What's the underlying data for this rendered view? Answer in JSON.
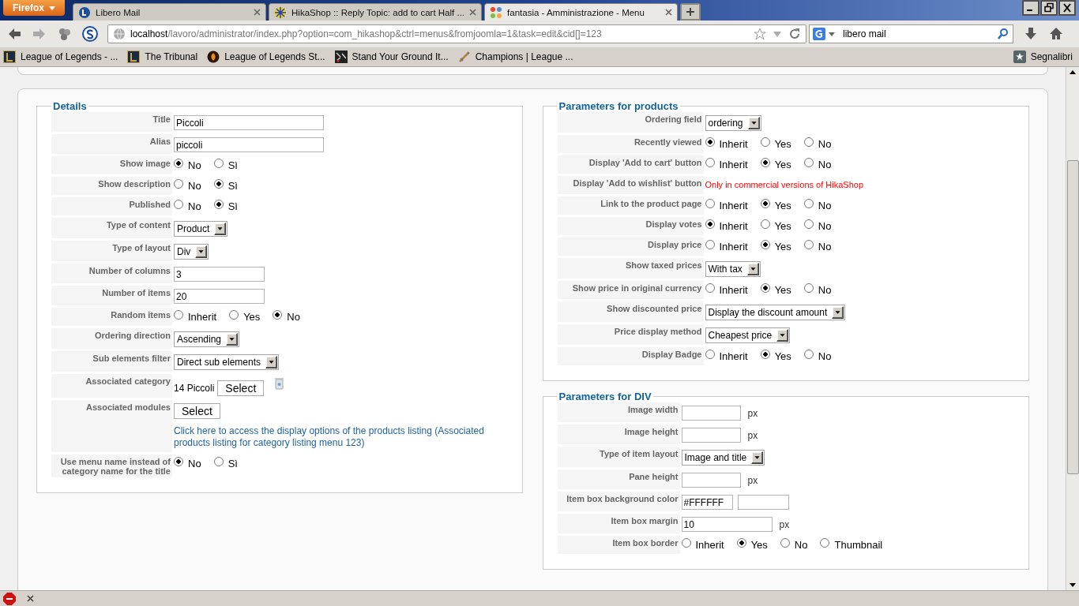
{
  "browser": {
    "menu_button": "Firefox",
    "tabs": [
      {
        "title": "Libero Mail",
        "selected": false
      },
      {
        "title": "HikaShop :: Reply Topic: add to cart Half ...",
        "selected": false
      },
      {
        "title": "fantasia - Amministrazione - Menu",
        "selected": true
      }
    ],
    "url": {
      "host": "localhost",
      "path": "/lavoro/administrator/index.php?option=com_hikashop&ctrl=menus&fromjoomla=1&task=edit&cid[]=123"
    },
    "search": "libero mail",
    "bookmarks": [
      "League of Legends - ...",
      "The Tribunal",
      "League of Legends St...",
      "Stand Your Ground It...",
      "Champions | League ..."
    ],
    "bookmarks_menu": "Segnalibri"
  },
  "details": {
    "legend": "Details",
    "rows": [
      {
        "kind": "text",
        "label": "Title",
        "value": "Piccoli"
      },
      {
        "kind": "text",
        "label": "Alias",
        "value": "piccoli"
      },
      {
        "kind": "radio",
        "label": "Show image",
        "options": [
          {
            "label": "No",
            "selected": true
          },
          {
            "label": "Sì",
            "selected": false
          }
        ]
      },
      {
        "kind": "radio",
        "label": "Show description",
        "options": [
          {
            "label": "No",
            "selected": false
          },
          {
            "label": "Sì",
            "selected": true
          }
        ]
      },
      {
        "kind": "radio",
        "label": "Published",
        "options": [
          {
            "label": "No",
            "selected": false
          },
          {
            "label": "Sì",
            "selected": true
          }
        ]
      },
      {
        "kind": "select",
        "label": "Type of content",
        "value": "Product"
      },
      {
        "kind": "select",
        "label": "Type of layout",
        "value": "Div"
      },
      {
        "kind": "number",
        "label": "Number of columns",
        "value": "3"
      },
      {
        "kind": "number",
        "label": "Number of items",
        "value": "20"
      },
      {
        "kind": "radio",
        "label": "Random items",
        "options": [
          {
            "label": "Inherit",
            "selected": false
          },
          {
            "label": "Yes",
            "selected": false
          },
          {
            "label": "No",
            "selected": true
          }
        ]
      },
      {
        "kind": "select",
        "label": "Ordering direction",
        "value": "Ascending"
      },
      {
        "kind": "select",
        "label": "Sub elements filter",
        "value": "Direct sub elements"
      },
      {
        "kind": "category",
        "label": "Associated category",
        "value": "14 Piccoli",
        "button": "Select"
      },
      {
        "kind": "modules",
        "label": "Associated modules",
        "button": "Select",
        "link": "Click here to access the display options of the products listing (Associated products listing for category listing menu 123)"
      },
      {
        "kind": "radio",
        "label": "Use menu name instead of category name for the title",
        "options": [
          {
            "label": "No",
            "selected": true
          },
          {
            "label": "Sì",
            "selected": false
          }
        ]
      }
    ]
  },
  "products": {
    "legend": "Parameters for products",
    "rows": [
      {
        "kind": "select",
        "label": "Ordering field",
        "value": "ordering"
      },
      {
        "kind": "radio",
        "label": "Recently viewed",
        "options": [
          {
            "label": "Inherit",
            "selected": true
          },
          {
            "label": "Yes",
            "selected": false
          },
          {
            "label": "No",
            "selected": false
          }
        ]
      },
      {
        "kind": "radio",
        "label": "Display 'Add to cart' button",
        "options": [
          {
            "label": "Inherit",
            "selected": false
          },
          {
            "label": "Yes",
            "selected": true
          },
          {
            "label": "No",
            "selected": false
          }
        ]
      },
      {
        "kind": "note",
        "label": "Display 'Add to wishlist' button",
        "text": "Only in commercial versions of HikaShop"
      },
      {
        "kind": "radio",
        "label": "Link to the product page",
        "options": [
          {
            "label": "Inherit",
            "selected": false
          },
          {
            "label": "Yes",
            "selected": true
          },
          {
            "label": "No",
            "selected": false
          }
        ]
      },
      {
        "kind": "radio",
        "label": "Display votes",
        "options": [
          {
            "label": "Inherit",
            "selected": true
          },
          {
            "label": "Yes",
            "selected": false
          },
          {
            "label": "No",
            "selected": false
          }
        ]
      },
      {
        "kind": "radio",
        "label": "Display price",
        "options": [
          {
            "label": "Inherit",
            "selected": false
          },
          {
            "label": "Yes",
            "selected": true
          },
          {
            "label": "No",
            "selected": false
          }
        ]
      },
      {
        "kind": "select",
        "label": "Show taxed prices",
        "value": "With tax"
      },
      {
        "kind": "radio",
        "label": "Show price in original currency",
        "options": [
          {
            "label": "Inherit",
            "selected": false
          },
          {
            "label": "Yes",
            "selected": true
          },
          {
            "label": "No",
            "selected": false
          }
        ]
      },
      {
        "kind": "select",
        "label": "Show discounted price",
        "value": "Display the discount amount"
      },
      {
        "kind": "select",
        "label": "Price display method",
        "value": "Cheapest price"
      },
      {
        "kind": "radio",
        "label": "Display Badge",
        "options": [
          {
            "label": "Inherit",
            "selected": false
          },
          {
            "label": "Yes",
            "selected": true
          },
          {
            "label": "No",
            "selected": false
          }
        ]
      }
    ]
  },
  "div": {
    "legend": "Parameters for DIV",
    "rows": [
      {
        "kind": "px",
        "label": "Image width",
        "unit": "px"
      },
      {
        "kind": "px",
        "label": "Image height",
        "unit": "px"
      },
      {
        "kind": "select",
        "label": "Type of item layout",
        "value": "Image and title"
      },
      {
        "kind": "px",
        "label": "Pane height",
        "unit": "px"
      },
      {
        "kind": "color",
        "label": "Item box background color",
        "value": "#FFFFFF"
      },
      {
        "kind": "px",
        "label": "Item box margin",
        "value": "10",
        "unit": "px"
      },
      {
        "kind": "radio",
        "label": "Item box border",
        "options": [
          {
            "label": "Inherit",
            "selected": false
          },
          {
            "label": "Yes",
            "selected": true
          },
          {
            "label": "No",
            "selected": false
          },
          {
            "label": "Thumbnail",
            "selected": false
          }
        ]
      }
    ]
  }
}
